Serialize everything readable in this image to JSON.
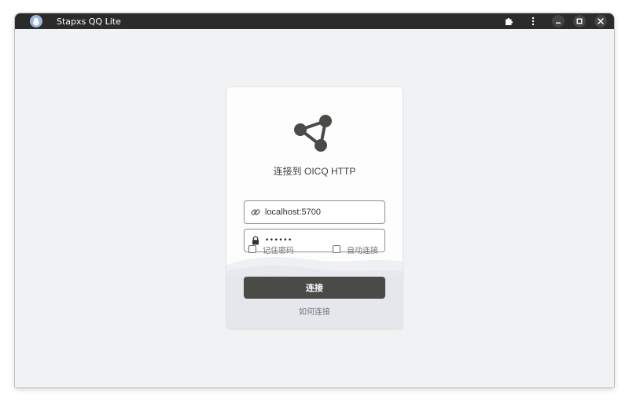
{
  "window": {
    "title": "Stapxs QQ Lite",
    "icons": [
      "app-icon",
      "puzzle-icon",
      "more-vert-icon",
      "minimize-icon",
      "maximize-icon",
      "close-icon"
    ]
  },
  "login": {
    "logo_icon": "network-triangle-logo-icon",
    "title": "连接到 OICQ HTTP",
    "address": {
      "icon": "link-icon",
      "value": "localhost:5700"
    },
    "token": {
      "icon": "lock-icon",
      "value": "••••••"
    },
    "remember_password": {
      "label": "记住密码",
      "checked": false
    },
    "auto_connect": {
      "label": "自动连接",
      "checked": false
    },
    "connect_button": "连接",
    "help_link": "如何连接"
  },
  "colors": {
    "titlebar": "#2b2b2b",
    "background": "#f1f2f4",
    "card": "#fdfdfd",
    "button": "#4a4b47",
    "logo": "#4a4b47"
  }
}
